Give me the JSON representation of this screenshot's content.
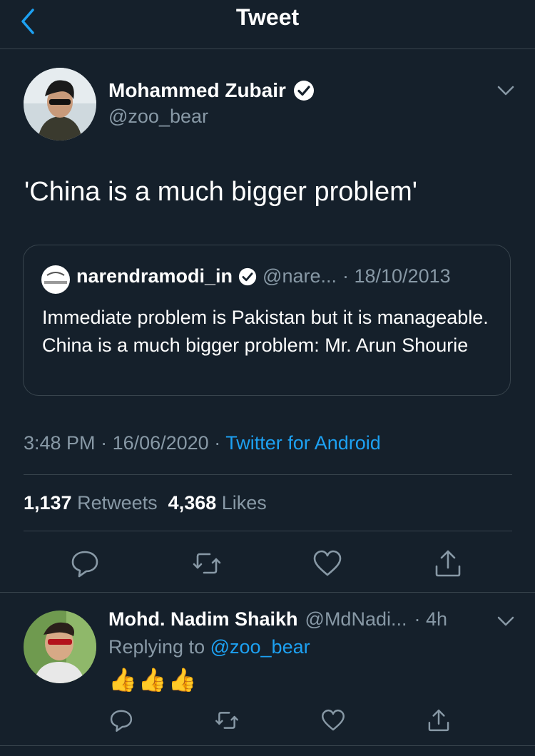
{
  "header": {
    "title": "Tweet",
    "back_icon": "chevron-left-icon"
  },
  "tweet": {
    "author_name": "Mohammed Zubair",
    "author_handle": "@zoo_bear",
    "text": "'China is a much bigger problem'",
    "quoted": {
      "name": "narendramodi_in",
      "handle": "@nare...",
      "date": "· 18/10/2013",
      "text": "Immediate problem is Pakistan but it is manageable. China is a much bigger problem: Mr. Arun Shourie"
    },
    "time": "3:48 PM",
    "sep1": " · ",
    "date": "16/06/2020",
    "sep2": " · ",
    "source": "Twitter for Android",
    "retweets_count": "1,137",
    "retweets_label": "Retweets",
    "likes_count": "4,368",
    "likes_label": "Likes"
  },
  "reply": {
    "name": "Mohd. Nadim Shaikh",
    "handle": "@MdNadi...",
    "time": "· 4h",
    "replying_label": "Replying to ",
    "replying_to": "@zoo_bear",
    "text": "👍👍👍"
  },
  "colors": {
    "background": "#15202b",
    "accent": "#1da1f2",
    "muted": "#8899a6",
    "border": "#38444d"
  }
}
